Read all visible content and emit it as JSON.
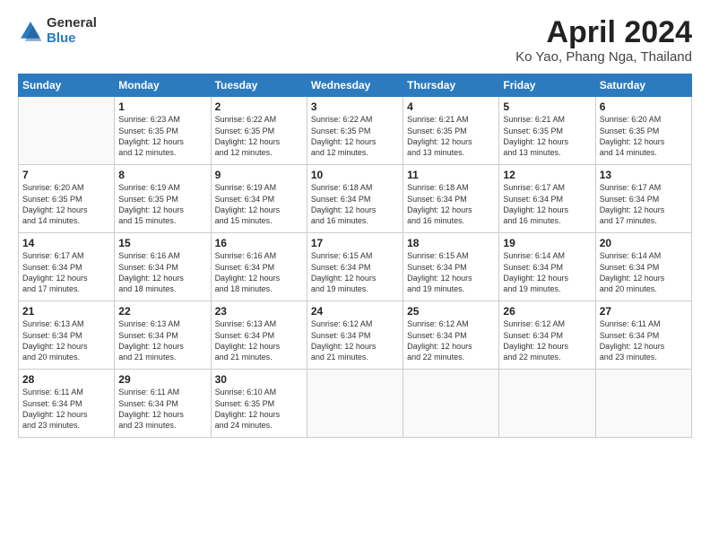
{
  "header": {
    "logo_general": "General",
    "logo_blue": "Blue",
    "title": "April 2024",
    "subtitle": "Ko Yao, Phang Nga, Thailand"
  },
  "weekdays": [
    "Sunday",
    "Monday",
    "Tuesday",
    "Wednesday",
    "Thursday",
    "Friday",
    "Saturday"
  ],
  "weeks": [
    [
      {
        "day": "",
        "info": ""
      },
      {
        "day": "1",
        "info": "Sunrise: 6:23 AM\nSunset: 6:35 PM\nDaylight: 12 hours\nand 12 minutes."
      },
      {
        "day": "2",
        "info": "Sunrise: 6:22 AM\nSunset: 6:35 PM\nDaylight: 12 hours\nand 12 minutes."
      },
      {
        "day": "3",
        "info": "Sunrise: 6:22 AM\nSunset: 6:35 PM\nDaylight: 12 hours\nand 12 minutes."
      },
      {
        "day": "4",
        "info": "Sunrise: 6:21 AM\nSunset: 6:35 PM\nDaylight: 12 hours\nand 13 minutes."
      },
      {
        "day": "5",
        "info": "Sunrise: 6:21 AM\nSunset: 6:35 PM\nDaylight: 12 hours\nand 13 minutes."
      },
      {
        "day": "6",
        "info": "Sunrise: 6:20 AM\nSunset: 6:35 PM\nDaylight: 12 hours\nand 14 minutes."
      }
    ],
    [
      {
        "day": "7",
        "info": "Sunrise: 6:20 AM\nSunset: 6:35 PM\nDaylight: 12 hours\nand 14 minutes."
      },
      {
        "day": "8",
        "info": "Sunrise: 6:19 AM\nSunset: 6:35 PM\nDaylight: 12 hours\nand 15 minutes."
      },
      {
        "day": "9",
        "info": "Sunrise: 6:19 AM\nSunset: 6:34 PM\nDaylight: 12 hours\nand 15 minutes."
      },
      {
        "day": "10",
        "info": "Sunrise: 6:18 AM\nSunset: 6:34 PM\nDaylight: 12 hours\nand 16 minutes."
      },
      {
        "day": "11",
        "info": "Sunrise: 6:18 AM\nSunset: 6:34 PM\nDaylight: 12 hours\nand 16 minutes."
      },
      {
        "day": "12",
        "info": "Sunrise: 6:17 AM\nSunset: 6:34 PM\nDaylight: 12 hours\nand 16 minutes."
      },
      {
        "day": "13",
        "info": "Sunrise: 6:17 AM\nSunset: 6:34 PM\nDaylight: 12 hours\nand 17 minutes."
      }
    ],
    [
      {
        "day": "14",
        "info": "Sunrise: 6:17 AM\nSunset: 6:34 PM\nDaylight: 12 hours\nand 17 minutes."
      },
      {
        "day": "15",
        "info": "Sunrise: 6:16 AM\nSunset: 6:34 PM\nDaylight: 12 hours\nand 18 minutes."
      },
      {
        "day": "16",
        "info": "Sunrise: 6:16 AM\nSunset: 6:34 PM\nDaylight: 12 hours\nand 18 minutes."
      },
      {
        "day": "17",
        "info": "Sunrise: 6:15 AM\nSunset: 6:34 PM\nDaylight: 12 hours\nand 19 minutes."
      },
      {
        "day": "18",
        "info": "Sunrise: 6:15 AM\nSunset: 6:34 PM\nDaylight: 12 hours\nand 19 minutes."
      },
      {
        "day": "19",
        "info": "Sunrise: 6:14 AM\nSunset: 6:34 PM\nDaylight: 12 hours\nand 19 minutes."
      },
      {
        "day": "20",
        "info": "Sunrise: 6:14 AM\nSunset: 6:34 PM\nDaylight: 12 hours\nand 20 minutes."
      }
    ],
    [
      {
        "day": "21",
        "info": "Sunrise: 6:13 AM\nSunset: 6:34 PM\nDaylight: 12 hours\nand 20 minutes."
      },
      {
        "day": "22",
        "info": "Sunrise: 6:13 AM\nSunset: 6:34 PM\nDaylight: 12 hours\nand 21 minutes."
      },
      {
        "day": "23",
        "info": "Sunrise: 6:13 AM\nSunset: 6:34 PM\nDaylight: 12 hours\nand 21 minutes."
      },
      {
        "day": "24",
        "info": "Sunrise: 6:12 AM\nSunset: 6:34 PM\nDaylight: 12 hours\nand 21 minutes."
      },
      {
        "day": "25",
        "info": "Sunrise: 6:12 AM\nSunset: 6:34 PM\nDaylight: 12 hours\nand 22 minutes."
      },
      {
        "day": "26",
        "info": "Sunrise: 6:12 AM\nSunset: 6:34 PM\nDaylight: 12 hours\nand 22 minutes."
      },
      {
        "day": "27",
        "info": "Sunrise: 6:11 AM\nSunset: 6:34 PM\nDaylight: 12 hours\nand 23 minutes."
      }
    ],
    [
      {
        "day": "28",
        "info": "Sunrise: 6:11 AM\nSunset: 6:34 PM\nDaylight: 12 hours\nand 23 minutes."
      },
      {
        "day": "29",
        "info": "Sunrise: 6:11 AM\nSunset: 6:34 PM\nDaylight: 12 hours\nand 23 minutes."
      },
      {
        "day": "30",
        "info": "Sunrise: 6:10 AM\nSunset: 6:35 PM\nDaylight: 12 hours\nand 24 minutes."
      },
      {
        "day": "",
        "info": ""
      },
      {
        "day": "",
        "info": ""
      },
      {
        "day": "",
        "info": ""
      },
      {
        "day": "",
        "info": ""
      }
    ]
  ]
}
